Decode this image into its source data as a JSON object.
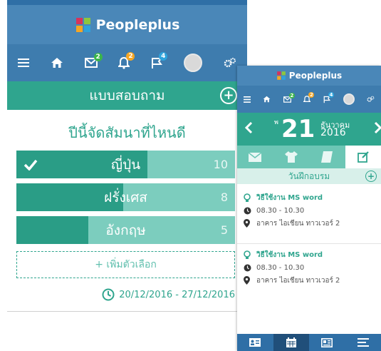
{
  "colors": {
    "brand_blue": "#4a87b8",
    "nav_blue": "#3e7cae",
    "teal": "#2fa58e",
    "teal_light": "#7ccdbe"
  },
  "left": {
    "brand": "Peopleplus",
    "nav": {
      "menu_icon": "hamburger-icon",
      "home_icon": "home-icon",
      "mail_badge": "2",
      "bell_badge": "2",
      "flag_badge": "4",
      "settings_icon": "gears-icon"
    },
    "page_title": "แบบสอบถาม",
    "question": "ปีนี้จัดสัมนาที่ไหนดี",
    "options": [
      {
        "label": "ญี่ปุ่น",
        "count": "10",
        "fraction": 0.6,
        "checked": true
      },
      {
        "label": "ฝรั่งเศส",
        "count": "8",
        "fraction": 0.49,
        "checked": false
      },
      {
        "label": "อังกฤษ",
        "count": "5",
        "fraction": 0.33,
        "checked": false
      }
    ],
    "add_option": "+ เพิ่มตัวเลือก",
    "date_range": "20/12/2016 - 27/12/2016"
  },
  "right": {
    "brand": "Peopleplus",
    "nav": {
      "mail_badge": "2",
      "bell_badge": "2",
      "flag_badge": "4"
    },
    "date": {
      "day_abbr": "พ",
      "day": "21",
      "month": "ธันวาคม",
      "year": "2016"
    },
    "section_title": "วันฝึกอบรม",
    "events": [
      {
        "title": "วิธีใช้งาน MS word",
        "time": "08.30 - 10.30",
        "place": "อาคาร ไอเชียน ทาวเวอร์ 2"
      },
      {
        "title": "วิธีใช้งาน MS word",
        "time": "08.30 - 10.30",
        "place": "อาคาร ไอเชียน ทาวเวอร์ 2"
      }
    ]
  }
}
